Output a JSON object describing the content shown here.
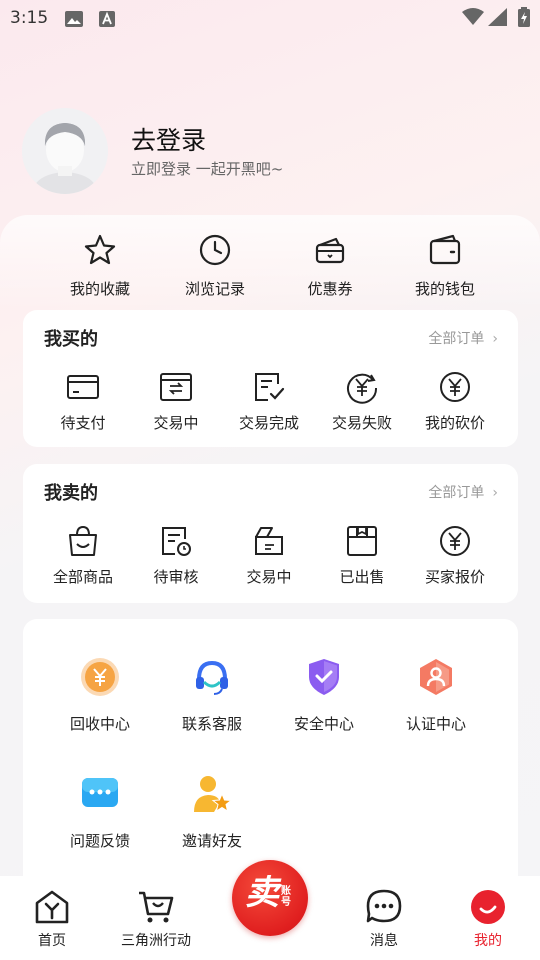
{
  "status_bar": {
    "time": "3:15",
    "icons": [
      "image-icon",
      "a-icon",
      "wifi-icon",
      "signal-icon",
      "battery-icon"
    ]
  },
  "profile": {
    "title": "去登录",
    "subtitle": "立即登录 一起开黑吧~"
  },
  "shortcuts": [
    {
      "label": "我的收藏",
      "icon": "star-icon"
    },
    {
      "label": "浏览记录",
      "icon": "clock-icon"
    },
    {
      "label": "优惠券",
      "icon": "coupon-icon"
    },
    {
      "label": "我的钱包",
      "icon": "wallet-icon"
    }
  ],
  "buy_section": {
    "title": "我买的",
    "link": "全部订单",
    "items": [
      {
        "label": "待支付",
        "icon": "card-icon"
      },
      {
        "label": "交易中",
        "icon": "exchange-icon"
      },
      {
        "label": "交易完成",
        "icon": "done-icon"
      },
      {
        "label": "交易失败",
        "icon": "failed-icon"
      },
      {
        "label": "我的砍价",
        "icon": "bargain-icon"
      }
    ]
  },
  "sell_section": {
    "title": "我卖的",
    "link": "全部订单",
    "items": [
      {
        "label": "全部商品",
        "icon": "bag-icon"
      },
      {
        "label": "待审核",
        "icon": "review-icon"
      },
      {
        "label": "交易中",
        "icon": "box-icon"
      },
      {
        "label": "已出售",
        "icon": "sold-icon"
      },
      {
        "label": "买家报价",
        "icon": "quote-icon"
      }
    ]
  },
  "services": [
    {
      "label": "回收中心",
      "icon": "recycle-icon"
    },
    {
      "label": "联系客服",
      "icon": "headset-icon"
    },
    {
      "label": "安全中心",
      "icon": "shield-icon"
    },
    {
      "label": "认证中心",
      "icon": "certify-icon"
    },
    {
      "label": "问题反馈",
      "icon": "feedback-icon"
    },
    {
      "label": "邀请好友",
      "icon": "invite-icon"
    }
  ],
  "bottom_nav": {
    "items": [
      {
        "label": "首页",
        "icon": "home-icon"
      },
      {
        "label": "三角洲行动",
        "icon": "cart-icon"
      },
      {
        "label": "消息",
        "icon": "message-icon"
      },
      {
        "label": "我的",
        "icon": "profile-icon"
      }
    ],
    "sell_button": {
      "big": "卖",
      "small": "账号"
    }
  },
  "colors": {
    "accent": "#e8222e",
    "text": "#222222",
    "muted": "#999999"
  }
}
